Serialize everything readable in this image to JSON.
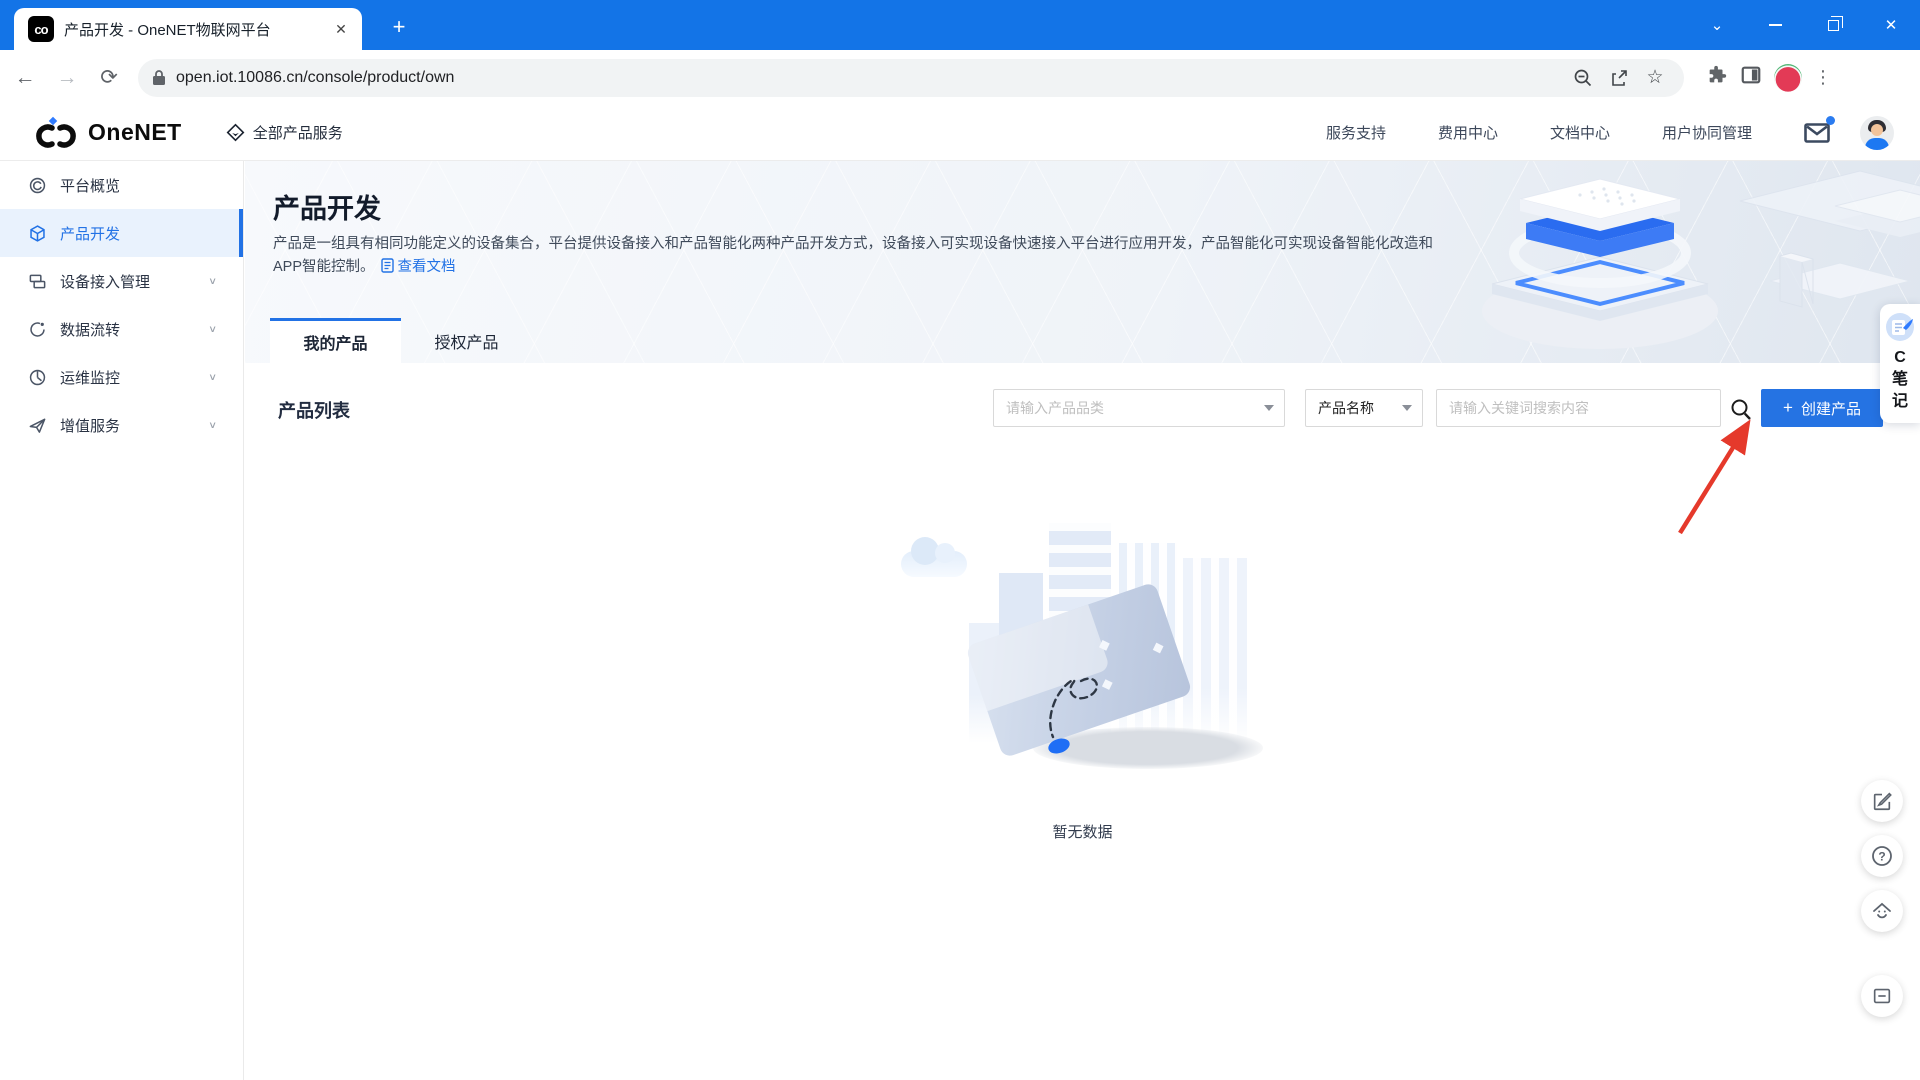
{
  "browser": {
    "tab_title": "产品开发 - OneNET物联网平台",
    "url": "open.iot.10086.cn/console/product/own",
    "favicon_glyph": "co",
    "icons": {
      "close_tab": "✕",
      "new_tab": "+",
      "chevron_down": "⌄",
      "close_window": "✕",
      "back": "←",
      "forward": "→",
      "reload": "⟳",
      "star": "☆",
      "menu_dots": "⋮"
    }
  },
  "header": {
    "logo_text": "OneNET",
    "all_products": "全部产品服务",
    "links": [
      "服务支持",
      "费用中心",
      "文档中心",
      "用户协同管理"
    ]
  },
  "sidebar": {
    "items": [
      {
        "label": "平台概览"
      },
      {
        "label": "产品开发"
      },
      {
        "label": "设备接入管理",
        "chevron": "∨"
      },
      {
        "label": "数据流转",
        "chevron": "∨"
      },
      {
        "label": "运维监控",
        "chevron": "∨"
      },
      {
        "label": "增值服务",
        "chevron": "∨"
      }
    ]
  },
  "banner": {
    "title": "产品开发",
    "description": "产品是一组具有相同功能定义的设备集合，平台提供设备接入和产品智能化两种产品开发方式，设备接入可实现设备快速接入平台进行应用开发，产品智能化可实现设备智能化改造和APP智能控制。",
    "doc_link": "查看文档"
  },
  "tabs": [
    {
      "label": "我的产品"
    },
    {
      "label": "授权产品"
    }
  ],
  "content": {
    "list_title": "产品列表",
    "category_placeholder": "请输入产品品类",
    "name_filter_value": "产品名称",
    "keyword_placeholder": "请输入关键词搜索内容",
    "create_plus": "+",
    "create_label": "创建产品",
    "empty_text": "暂无数据"
  },
  "note_widget": {
    "letters": [
      "C",
      "笔",
      "记"
    ]
  },
  "colors": {
    "accent": "#2272e5",
    "chrome_blue": "#1374e7",
    "button_blue": "#2573e3",
    "arrow_red": "#e5392b"
  }
}
